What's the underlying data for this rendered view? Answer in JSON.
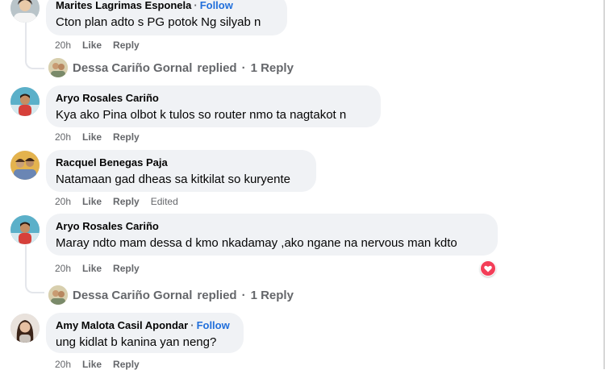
{
  "comments": [
    {
      "author": "Marites Lagrimas Esponela",
      "follow_label": "Follow",
      "text": "Cton plan adto s PG potok Ng silyab n",
      "time": "20h",
      "like_label": "Like",
      "reply_label": "Reply"
    },
    {
      "author": "Aryo Rosales Cariño",
      "text": "Kya ako Pina olbot k tulos so router nmo ta nagtakot n",
      "time": "20h",
      "like_label": "Like",
      "reply_label": "Reply"
    },
    {
      "author": "Racquel Benegas Paja",
      "text": "Natamaan gad dheas sa kitkilat so kuryente",
      "time": "20h",
      "like_label": "Like",
      "reply_label": "Reply",
      "edited_label": "Edited"
    },
    {
      "author": "Aryo Rosales Cariño",
      "text": "Maray ndto mam dessa d kmo nkadamay ,ako ngane na nervous man kdto",
      "time": "20h",
      "like_label": "Like",
      "reply_label": "Reply",
      "reaction_icon": "heart-reaction-icon"
    },
    {
      "author": "Amy Malota Casil Apondar",
      "follow_label": "Follow",
      "text": "ung kidlat b kanina yan neng?",
      "time": "20h",
      "like_label": "Like",
      "reply_label": "Reply"
    }
  ],
  "replies": [
    {
      "author": "Dessa Cariño Gornal",
      "suffix": "replied",
      "count_label": "1 Reply"
    },
    {
      "author": "Dessa Cariño Gornal",
      "suffix": "replied",
      "count_label": "1 Reply"
    }
  ],
  "separator": "·",
  "colors": {
    "bubble": "#f0f2f5",
    "link": "#216fdb",
    "muted": "#65676b",
    "heart": "#f33e58"
  }
}
